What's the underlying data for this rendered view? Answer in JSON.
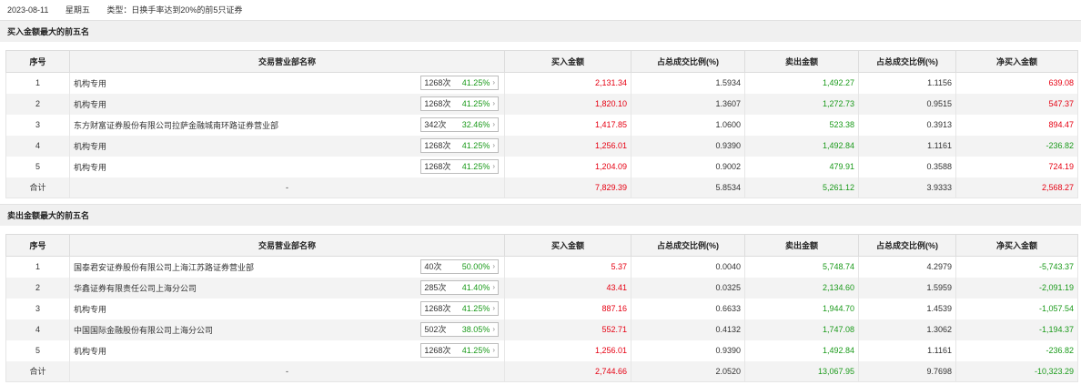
{
  "header": {
    "date": "2023-08-11",
    "weekday": "星期五",
    "type_label": "类型：日换手率达到20%的前5只证券"
  },
  "columns": [
    "序号",
    "交易营业部名称",
    "买入金额",
    "占总成交比例(%)",
    "卖出金额",
    "占总成交比例(%)",
    "净买入金额"
  ],
  "buy_section": {
    "title": "买入金额最大的前五名",
    "rows": [
      {
        "no": "1",
        "name": "机构专用",
        "count": "1268次",
        "pct": "41.25%",
        "buy": "2,131.34",
        "buy_ratio": "1.5934",
        "sell": "1,492.27",
        "sell_ratio": "1.1156",
        "net": "639.08",
        "net_sign": "pos"
      },
      {
        "no": "2",
        "name": "机构专用",
        "count": "1268次",
        "pct": "41.25%",
        "buy": "1,820.10",
        "buy_ratio": "1.3607",
        "sell": "1,272.73",
        "sell_ratio": "0.9515",
        "net": "547.37",
        "net_sign": "pos"
      },
      {
        "no": "3",
        "name": "东方财富证券股份有限公司拉萨金融城南环路证券营业部",
        "count": "342次",
        "pct": "32.46%",
        "buy": "1,417.85",
        "buy_ratio": "1.0600",
        "sell": "523.38",
        "sell_ratio": "0.3913",
        "net": "894.47",
        "net_sign": "pos"
      },
      {
        "no": "4",
        "name": "机构专用",
        "count": "1268次",
        "pct": "41.25%",
        "buy": "1,256.01",
        "buy_ratio": "0.9390",
        "sell": "1,492.84",
        "sell_ratio": "1.1161",
        "net": "-236.82",
        "net_sign": "neg"
      },
      {
        "no": "5",
        "name": "机构专用",
        "count": "1268次",
        "pct": "41.25%",
        "buy": "1,204.09",
        "buy_ratio": "0.9002",
        "sell": "479.91",
        "sell_ratio": "0.3588",
        "net": "724.19",
        "net_sign": "pos"
      }
    ],
    "total": {
      "label": "合计",
      "name": "-",
      "buy": "7,829.39",
      "buy_ratio": "5.8534",
      "sell": "5,261.12",
      "sell_ratio": "3.9333",
      "net": "2,568.27",
      "net_sign": "pos"
    }
  },
  "sell_section": {
    "title": "卖出金额最大的前五名",
    "rows": [
      {
        "no": "1",
        "name": "国泰君安证券股份有限公司上海江苏路证券营业部",
        "count": "40次",
        "pct": "50.00%",
        "buy": "5.37",
        "buy_ratio": "0.0040",
        "sell": "5,748.74",
        "sell_ratio": "4.2979",
        "net": "-5,743.37",
        "net_sign": "neg"
      },
      {
        "no": "2",
        "name": "华鑫证券有限责任公司上海分公司",
        "count": "285次",
        "pct": "41.40%",
        "buy": "43.41",
        "buy_ratio": "0.0325",
        "sell": "2,134.60",
        "sell_ratio": "1.5959",
        "net": "-2,091.19",
        "net_sign": "neg"
      },
      {
        "no": "3",
        "name": "机构专用",
        "count": "1268次",
        "pct": "41.25%",
        "buy": "887.16",
        "buy_ratio": "0.6633",
        "sell": "1,944.70",
        "sell_ratio": "1.4539",
        "net": "-1,057.54",
        "net_sign": "neg"
      },
      {
        "no": "4",
        "name": "中国国际金融股份有限公司上海分公司",
        "count": "502次",
        "pct": "38.05%",
        "buy": "552.71",
        "buy_ratio": "0.4132",
        "sell": "1,747.08",
        "sell_ratio": "1.3062",
        "net": "-1,194.37",
        "net_sign": "neg"
      },
      {
        "no": "5",
        "name": "机构专用",
        "count": "1268次",
        "pct": "41.25%",
        "buy": "1,256.01",
        "buy_ratio": "0.9390",
        "sell": "1,492.84",
        "sell_ratio": "1.1161",
        "net": "-236.82",
        "net_sign": "neg"
      }
    ],
    "total": {
      "label": "合计",
      "name": "-",
      "buy": "2,744.66",
      "buy_ratio": "2.0520",
      "sell": "13,067.95",
      "sell_ratio": "9.7698",
      "net": "-10,323.29",
      "net_sign": "neg"
    }
  },
  "colors": {
    "positive": "#e60012",
    "negative": "#1a9a1a",
    "header_bg": "#f3f3f3"
  },
  "icons": {
    "expand": "chevron-right-icon"
  }
}
